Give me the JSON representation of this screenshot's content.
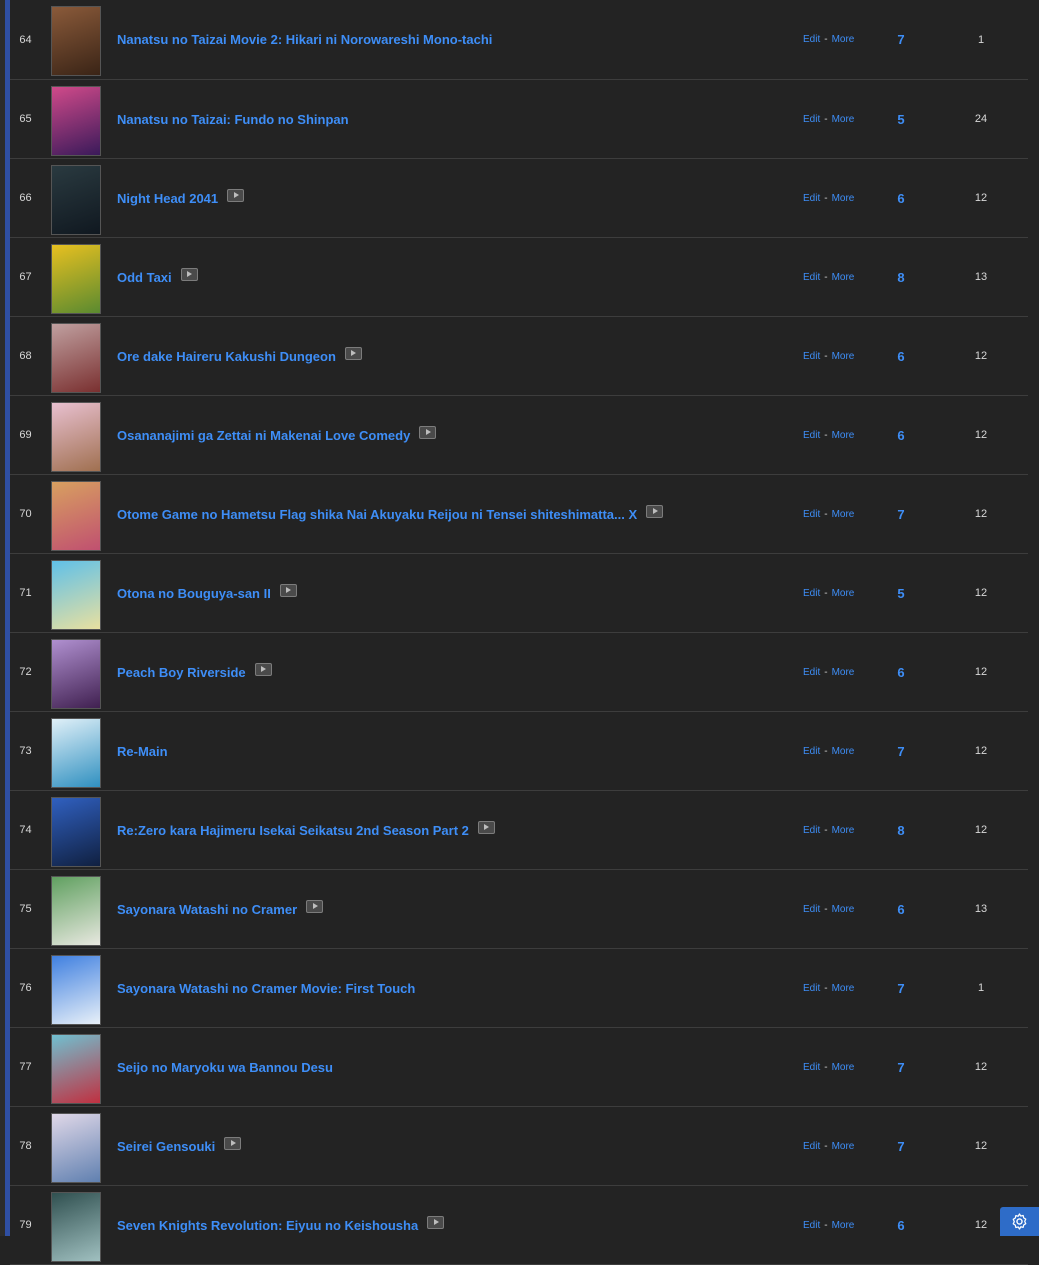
{
  "ui": {
    "edit_label": "Edit",
    "separator": "-",
    "more_label": "More"
  },
  "colors": {
    "link": "#3e8ef7",
    "status_bar": "#2f4fa3",
    "background": "#232323"
  },
  "rows": [
    {
      "num": "64",
      "title": "Nanatsu no Taizai Movie 2: Hikari ni Norowareshi Mono-tachi",
      "streaming": false,
      "score": "7",
      "episodes": "1",
      "thumb": [
        "#8a5a3a",
        "#3a2416"
      ]
    },
    {
      "num": "65",
      "title": "Nanatsu no Taizai: Fundo no Shinpan",
      "streaming": false,
      "score": "5",
      "episodes": "24",
      "thumb": [
        "#d04a8a",
        "#3a1a5a"
      ]
    },
    {
      "num": "66",
      "title": "Night Head 2041",
      "streaming": true,
      "score": "6",
      "episodes": "12",
      "thumb": [
        "#2a3a40",
        "#101820"
      ]
    },
    {
      "num": "67",
      "title": "Odd Taxi",
      "streaming": true,
      "score": "8",
      "episodes": "13",
      "thumb": [
        "#e8c020",
        "#5a8a30"
      ]
    },
    {
      "num": "68",
      "title": "Ore dake Haireru Kakushi Dungeon",
      "streaming": true,
      "score": "6",
      "episodes": "12",
      "thumb": [
        "#c0a0a0",
        "#7a3030"
      ]
    },
    {
      "num": "69",
      "title": "Osananajimi ga Zettai ni Makenai Love Comedy",
      "streaming": true,
      "score": "6",
      "episodes": "12",
      "thumb": [
        "#e8c0d0",
        "#a07050"
      ]
    },
    {
      "num": "70",
      "title": "Otome Game no Hametsu Flag shika Nai Akuyaku Reijou ni Tensei shiteshimatta... X",
      "streaming": true,
      "score": "7",
      "episodes": "12",
      "thumb": [
        "#d8a060",
        "#c05070"
      ]
    },
    {
      "num": "71",
      "title": "Otona no Bouguya-san II",
      "streaming": true,
      "score": "5",
      "episodes": "12",
      "thumb": [
        "#60c0e8",
        "#e8e0a0"
      ]
    },
    {
      "num": "72",
      "title": "Peach Boy Riverside",
      "streaming": true,
      "score": "6",
      "episodes": "12",
      "thumb": [
        "#b090d0",
        "#402050"
      ]
    },
    {
      "num": "73",
      "title": "Re-Main",
      "streaming": false,
      "score": "7",
      "episodes": "12",
      "thumb": [
        "#e0f0f8",
        "#3090c0"
      ]
    },
    {
      "num": "74",
      "title": "Re:Zero kara Hajimeru Isekai Seikatsu 2nd Season Part 2",
      "streaming": true,
      "score": "8",
      "episodes": "12",
      "thumb": [
        "#3060c0",
        "#102040"
      ]
    },
    {
      "num": "75",
      "title": "Sayonara Watashi no Cramer",
      "streaming": true,
      "score": "6",
      "episodes": "13",
      "thumb": [
        "#60a060",
        "#e8e8e0"
      ]
    },
    {
      "num": "76",
      "title": "Sayonara Watashi no Cramer Movie: First Touch",
      "streaming": false,
      "score": "7",
      "episodes": "1",
      "thumb": [
        "#4080e0",
        "#e8f0f8"
      ]
    },
    {
      "num": "77",
      "title": "Seijo no Maryoku wa Bannou Desu",
      "streaming": false,
      "score": "7",
      "episodes": "12",
      "thumb": [
        "#70c0d0",
        "#c03040"
      ]
    },
    {
      "num": "78",
      "title": "Seirei Gensouki",
      "streaming": true,
      "score": "7",
      "episodes": "12",
      "thumb": [
        "#e0d8e8",
        "#6080b0"
      ]
    },
    {
      "num": "79",
      "title": "Seven Knights Revolution: Eiyuu no Keishousha",
      "streaming": true,
      "score": "6",
      "episodes": "12",
      "thumb": [
        "#305050",
        "#a0c0c0"
      ]
    }
  ]
}
